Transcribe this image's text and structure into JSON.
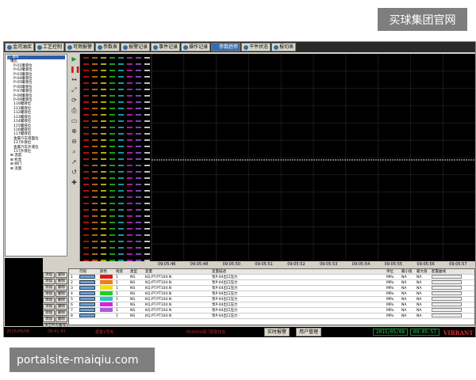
{
  "watermark_top": "买球集团官网",
  "watermark_bottom": "portalsite-maiqiu.com",
  "menu": {
    "tabs": [
      "金河油库",
      "工艺控制",
      "可燃报警",
      "参数表",
      "报警记录",
      "事件记录",
      "操作记录",
      "参数趋势",
      "干件状态",
      "报切表"
    ],
    "active_index": 7
  },
  "tree": {
    "items": [
      {
        "level": 0,
        "label": "□ 油库",
        "selected": true
      },
      {
        "level": 1,
        "label": "罐区"
      },
      {
        "level": 2,
        "label": "P-01罐液位"
      },
      {
        "level": 2,
        "label": "P-02罐液位"
      },
      {
        "level": 2,
        "label": "P-03罐液位"
      },
      {
        "level": 2,
        "label": "P-04罐液位"
      },
      {
        "level": 2,
        "label": "P-05罐液位"
      },
      {
        "level": 2,
        "label": "P-06罐液位"
      },
      {
        "level": 2,
        "label": "P-07罐液位"
      },
      {
        "level": 2,
        "label": "P-08罐液位"
      },
      {
        "level": 2,
        "label": "P-09罐液位"
      },
      {
        "level": 2,
        "label": "110罐液位"
      },
      {
        "level": 2,
        "label": "111罐液位"
      },
      {
        "level": 2,
        "label": "112罐液位"
      },
      {
        "level": 2,
        "label": "113罐液位"
      },
      {
        "level": 2,
        "label": "114罐液位"
      },
      {
        "level": 2,
        "label": "115罐液位"
      },
      {
        "level": 2,
        "label": "116罐液位"
      },
      {
        "level": 2,
        "label": "117罐液位"
      },
      {
        "level": 2,
        "label": "金属汽车液面位"
      },
      {
        "level": 2,
        "label": "117外液位"
      },
      {
        "level": 2,
        "label": "金属汽车外液位"
      },
      {
        "level": 2,
        "label": "117外液位"
      },
      {
        "level": 1,
        "label": "⊞ 温度"
      },
      {
        "level": 1,
        "label": "⊞ 机泵"
      },
      {
        "level": 1,
        "label": "⊞ 阀门"
      },
      {
        "level": 1,
        "label": "⊞ 流量"
      }
    ]
  },
  "side_buttons": [
    [
      "添加",
      "删除"
    ],
    [
      "添加",
      "删除"
    ],
    [
      "添加",
      "删除"
    ],
    [
      "添加",
      "删除"
    ],
    [
      "添加",
      "删除"
    ],
    [
      "添加",
      "删除"
    ],
    [
      "添加",
      "删除"
    ],
    [
      "添加",
      "删除"
    ]
  ],
  "side_bottom_button": "清空所有曲线",
  "toolbar_icons": [
    "play-icon",
    "pause-icon",
    "fit-width-icon",
    "fit-all-icon",
    "refresh-icon",
    "print-icon",
    "blank-icon",
    "zoom-in-icon",
    "zoom-out-icon",
    "zoom-area-icon",
    "pointer-icon",
    "reset-icon",
    "crosshair-icon"
  ],
  "time_axis": [
    "09:05:46",
    "09:05:48",
    "09:05:50",
    "09:05:51",
    "09:05:52",
    "09:05:53",
    "09:05:54",
    "09:05:55",
    "09:05:56",
    "09:05:57"
  ],
  "table": {
    "headers": [
      " ",
      "可视",
      "颜色",
      "线宽",
      "类型",
      "变量",
      "变量描述",
      "单位",
      "最小值",
      "最大值",
      "配置曲线"
    ],
    "rows": [
      {
        "no": "1",
        "color": "#e01818",
        "width": "1",
        "type": "NS",
        "var": "KQ.PT.PT104.N",
        "desc": "泵P-04出口压力",
        "unit": "MPa",
        "min": "NA",
        "max": "NA"
      },
      {
        "no": "2",
        "color": "#f08010",
        "width": "1",
        "type": "NS",
        "var": "KQ.PT.PT104.N",
        "desc": "泵P-04出口压力",
        "unit": "MPa",
        "min": "NA",
        "max": "NA"
      },
      {
        "no": "3",
        "color": "#f0e010",
        "width": "1",
        "type": "NS",
        "var": "KQ.PT.PT104.N",
        "desc": "泵P-04出口压力",
        "unit": "MPa",
        "min": "NA",
        "max": "NA"
      },
      {
        "no": "4",
        "color": "#20d020",
        "width": "1",
        "type": "NS",
        "var": "KQ.PT.PT104.N",
        "desc": "泵P-04出口压力",
        "unit": "MPa",
        "min": "NA",
        "max": "NA"
      },
      {
        "no": "5",
        "color": "#20c8c8",
        "width": "1",
        "type": "NS",
        "var": "KQ.PT.PT104.N",
        "desc": "泵P-04出口压力",
        "unit": "MPa",
        "min": "NA",
        "max": "NA"
      },
      {
        "no": "6",
        "color": "#e020e0",
        "width": "1",
        "type": "NS",
        "var": "KQ.PT.PT104.N",
        "desc": "泵P-04出口压力",
        "unit": "MPa",
        "min": "NA",
        "max": "NA"
      },
      {
        "no": "7",
        "color": "#a060e0",
        "width": "1",
        "type": "NS",
        "var": "KQ.PT.PT104.N",
        "desc": "泵P-04出口压力",
        "unit": "MPa",
        "min": "NA",
        "max": "NA"
      },
      {
        "no": "8",
        "color": "#ffffff",
        "width": "1",
        "type": "NS",
        "var": "KQ.PT.PT104.N",
        "desc": "泵P-04出口压力",
        "unit": "MPa",
        "min": "NA",
        "max": "NA"
      }
    ]
  },
  "status": {
    "date_left": "2015/05/08",
    "time_left": "09:41:43",
    "alarm_text": "报警1号库",
    "msg_text": "RV0002阀门报警状态",
    "realtime_btn": "实时报警",
    "user_btn": "用户管理",
    "date": "2015/05/08",
    "time": "09:05:57",
    "brand": "VIBRANT"
  },
  "colors": {
    "accent": "#3a6ea5",
    "chart_bg": "#000000",
    "trend_line": "#d8d8d8",
    "status_green": "#2adf62"
  }
}
